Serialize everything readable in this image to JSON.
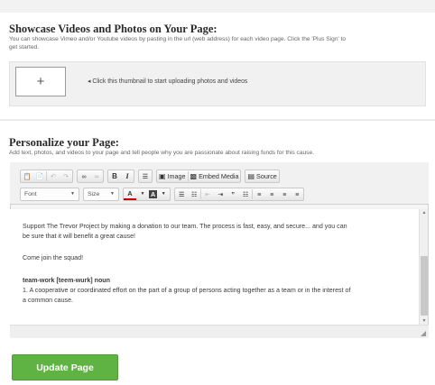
{
  "showcase": {
    "title": "Showcase Videos and Photos on Your Page:",
    "description_line1": "You can showcase Vimeo and/or Youtube videos by pasting in the url (web address) for each video page. Click the 'Plus Sign' to",
    "description_line2": "get started.",
    "thumb_label": "+",
    "hint": "◂ Click this thumbnail to start uploading photos and videos"
  },
  "personalize": {
    "title": "Personalize your Page:",
    "description": "Add text, photos, and videos to your page and tell people why you are passionate about raising funds for this cause."
  },
  "toolbar": {
    "row1": [
      {
        "name": "paste-icon",
        "label": "📋",
        "disabled": false
      },
      {
        "name": "paste-text-icon",
        "label": "📄",
        "disabled": false
      },
      {
        "name": "undo-icon",
        "label": "↶",
        "disabled": true
      },
      {
        "name": "redo-icon",
        "label": "↷",
        "disabled": true
      },
      {
        "name": "link-icon",
        "label": "∞",
        "disabled": false
      },
      {
        "name": "unlink-icon",
        "label": "≃",
        "disabled": true
      },
      {
        "name": "bold-icon",
        "label": "B",
        "disabled": false
      },
      {
        "name": "italic-icon",
        "label": "I",
        "disabled": false
      },
      {
        "name": "horizontal-rule-icon",
        "label": "☰",
        "disabled": false
      }
    ],
    "image_label": "Image",
    "embed_label": "Embed Media",
    "source_label": "Source",
    "font_label": "Font",
    "size_label": "Size",
    "text_color_label": "A",
    "bg_color_label": "A",
    "row2": [
      {
        "name": "numbered-list-icon",
        "label": "☰"
      },
      {
        "name": "bulleted-list-icon",
        "label": "☷"
      },
      {
        "name": "outdent-icon",
        "label": "⇤"
      },
      {
        "name": "indent-icon",
        "label": "⇥"
      },
      {
        "name": "blockquote-icon",
        "label": "”"
      },
      {
        "name": "div-icon",
        "label": "☷"
      },
      {
        "name": "align-left-icon",
        "label": "≡"
      },
      {
        "name": "align-center-icon",
        "label": "≡"
      },
      {
        "name": "align-right-icon",
        "label": "≡"
      },
      {
        "name": "justify-icon",
        "label": "≡"
      }
    ]
  },
  "editor_content": {
    "para1_line1": "Support The Trevor Project by making a donation to our team. The process is fast, easy, and secure... and you can",
    "para1_line2": "be sure that it will benefit a great cause!",
    "para2": "Come join the squad!",
    "term": "team-work [teem-wurk] noun",
    "definition_line1": "1. A cooperative or coordinated effort on the part of a group of persons acting together as a team or in the interest of",
    "definition_line2": "a common cause."
  },
  "actions": {
    "update_label": "Update Page"
  },
  "colors": {
    "update_button": "#5fb343",
    "panel_bg": "#f1f1f1"
  }
}
